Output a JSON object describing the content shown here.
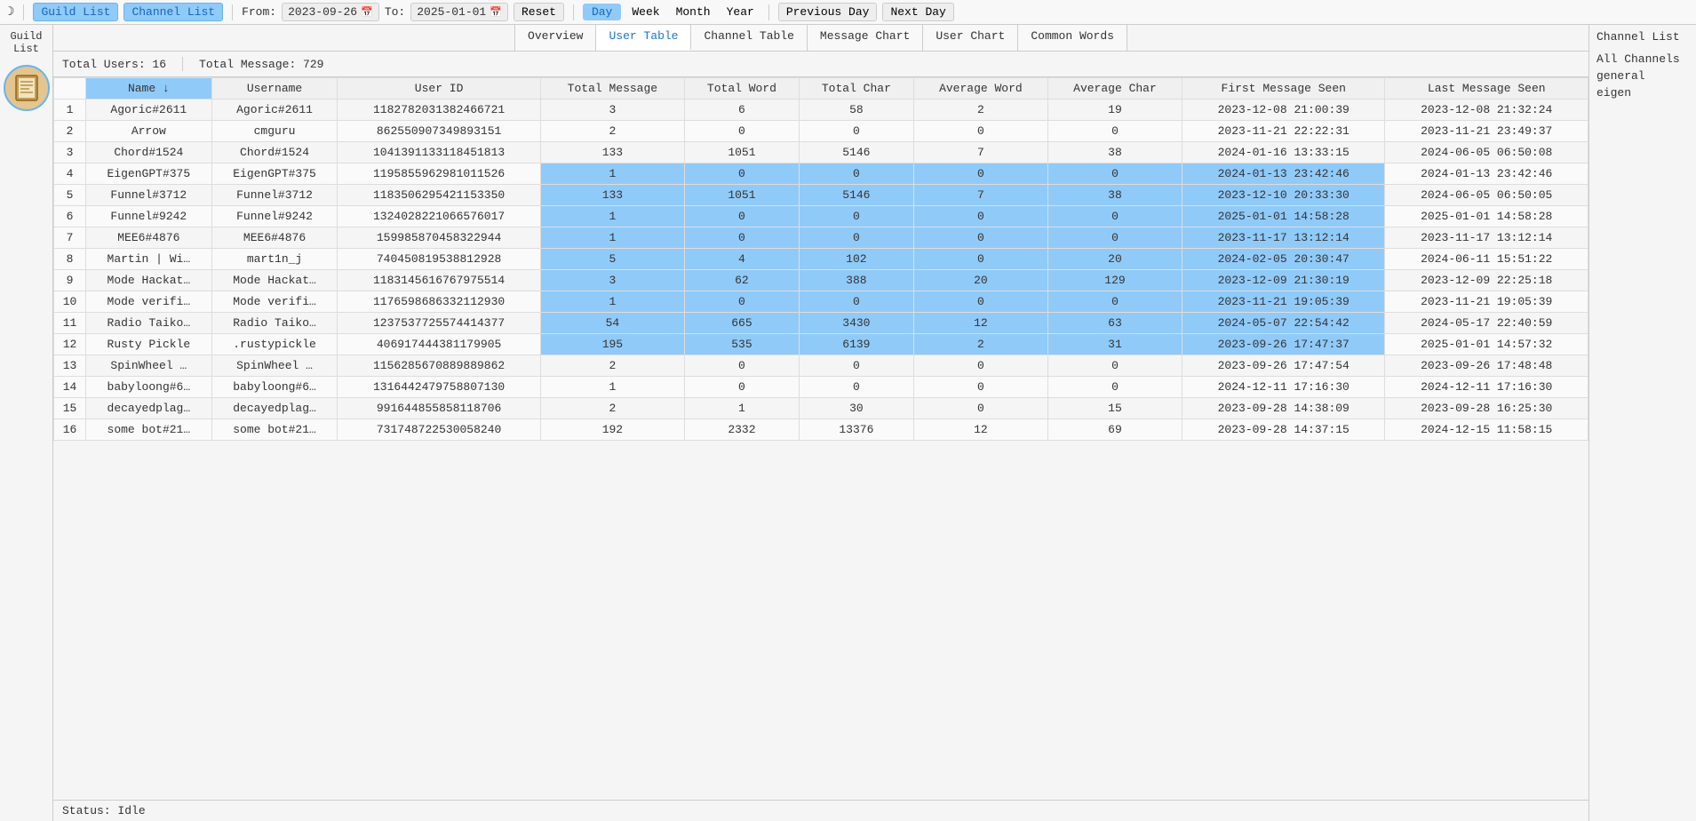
{
  "topbar": {
    "guild_list": "Guild List",
    "channel_list": "Channel List",
    "from_label": "From:",
    "from_date": "2023-09-26",
    "to_label": "To:",
    "to_date": "2025-01-01",
    "reset": "Reset",
    "day": "Day",
    "week": "Week",
    "month": "Month",
    "year": "Year",
    "prev_day": "Previous Day",
    "next_day": "Next Day"
  },
  "left_sidebar": {
    "title_line1": "Guild",
    "title_line2": "List"
  },
  "tabs": {
    "overview": "Overview",
    "user_table": "User Table",
    "channel_table": "Channel Table",
    "message_chart": "Message Chart",
    "user_chart": "User Chart",
    "common_words": "Common Words"
  },
  "stats": {
    "total_users": "Total Users: 16",
    "total_message": "Total Message: 729"
  },
  "columns": {
    "name": "Name ↓",
    "username": "Username",
    "user_id": "User ID",
    "total_msg": "Total Message",
    "total_word": "Total Word",
    "total_char": "Total Char",
    "avg_word": "Average Word",
    "avg_char": "Average Char",
    "first_seen": "First Message Seen",
    "last_seen": "Last Message Seen"
  },
  "rows": [
    {
      "n": "1",
      "name": "Agoric#2611",
      "user": "Agoric#2611",
      "id": "1182782031382466721",
      "tm": "3",
      "tw": "6",
      "tc": "58",
      "aw": "2",
      "ac": "19",
      "fs": "2023-12-08 21:00:39",
      "ls": "2023-12-08 21:32:24",
      "hl": false
    },
    {
      "n": "2",
      "name": "Arrow",
      "user": "cmguru",
      "id": "862550907349893151",
      "tm": "2",
      "tw": "0",
      "tc": "0",
      "aw": "0",
      "ac": "0",
      "fs": "2023-11-21 22:22:31",
      "ls": "2023-11-21 23:49:37",
      "hl": false
    },
    {
      "n": "3",
      "name": "Chord#1524",
      "user": "Chord#1524",
      "id": "1041391133118451813",
      "tm": "133",
      "tw": "1051",
      "tc": "5146",
      "aw": "7",
      "ac": "38",
      "fs": "2024-01-16 13:33:15",
      "ls": "2024-06-05 06:50:08",
      "hl": false
    },
    {
      "n": "4",
      "name": "EigenGPT#375",
      "user": "EigenGPT#375",
      "id": "1195855962981011526",
      "tm": "1",
      "tw": "0",
      "tc": "0",
      "aw": "0",
      "ac": "0",
      "fs": "2024-01-13 23:42:46",
      "ls": "2024-01-13 23:42:46",
      "hl": true
    },
    {
      "n": "5",
      "name": "Funnel#3712",
      "user": "Funnel#3712",
      "id": "1183506295421153350",
      "tm": "133",
      "tw": "1051",
      "tc": "5146",
      "aw": "7",
      "ac": "38",
      "fs": "2023-12-10 20:33:30",
      "ls": "2024-06-05 06:50:05",
      "hl": true
    },
    {
      "n": "6",
      "name": "Funnel#9242",
      "user": "Funnel#9242",
      "id": "1324028221066576017",
      "tm": "1",
      "tw": "0",
      "tc": "0",
      "aw": "0",
      "ac": "0",
      "fs": "2025-01-01 14:58:28",
      "ls": "2025-01-01 14:58:28",
      "hl": true
    },
    {
      "n": "7",
      "name": "MEE6#4876",
      "user": "MEE6#4876",
      "id": "159985870458322944",
      "tm": "1",
      "tw": "0",
      "tc": "0",
      "aw": "0",
      "ac": "0",
      "fs": "2023-11-17 13:12:14",
      "ls": "2023-11-17 13:12:14",
      "hl": true
    },
    {
      "n": "8",
      "name": "Martin | Wi…",
      "user": "mart1n_j",
      "id": "740450819538812928",
      "tm": "5",
      "tw": "4",
      "tc": "102",
      "aw": "0",
      "ac": "20",
      "fs": "2024-02-05 20:30:47",
      "ls": "2024-06-11 15:51:22",
      "hl": true
    },
    {
      "n": "9",
      "name": "Mode Hackat…",
      "user": "Mode Hackat…",
      "id": "1183145616767975514",
      "tm": "3",
      "tw": "62",
      "tc": "388",
      "aw": "20",
      "ac": "129",
      "fs": "2023-12-09 21:30:19",
      "ls": "2023-12-09 22:25:18",
      "hl": true
    },
    {
      "n": "10",
      "name": "Mode verifi…",
      "user": "Mode verifi…",
      "id": "1176598686332112930",
      "tm": "1",
      "tw": "0",
      "tc": "0",
      "aw": "0",
      "ac": "0",
      "fs": "2023-11-21 19:05:39",
      "ls": "2023-11-21 19:05:39",
      "hl": true
    },
    {
      "n": "11",
      "name": "Radio Taiko…",
      "user": "Radio Taiko…",
      "id": "1237537725574414377",
      "tm": "54",
      "tw": "665",
      "tc": "3430",
      "aw": "12",
      "ac": "63",
      "fs": "2024-05-07 22:54:42",
      "ls": "2024-05-17 22:40:59",
      "hl": true
    },
    {
      "n": "12",
      "name": "Rusty Pickle",
      "user": ".rustypickle",
      "id": "406917444381179905",
      "tm": "195",
      "tw": "535",
      "tc": "6139",
      "aw": "2",
      "ac": "31",
      "fs": "2023-09-26 17:47:37",
      "ls": "2025-01-01 14:57:32",
      "hl": true
    },
    {
      "n": "13",
      "name": "SpinWheel  …",
      "user": "SpinWheel  …",
      "id": "1156285670889889862",
      "tm": "2",
      "tw": "0",
      "tc": "0",
      "aw": "0",
      "ac": "0",
      "fs": "2023-09-26 17:47:54",
      "ls": "2023-09-26 17:48:48",
      "hl": false
    },
    {
      "n": "14",
      "name": "babyloong#6…",
      "user": "babyloong#6…",
      "id": "1316442479758807130",
      "tm": "1",
      "tw": "0",
      "tc": "0",
      "aw": "0",
      "ac": "0",
      "fs": "2024-12-11 17:16:30",
      "ls": "2024-12-11 17:16:30",
      "hl": false
    },
    {
      "n": "15",
      "name": "decayedplag…",
      "user": "decayedplag…",
      "id": "991644855858118706",
      "tm": "2",
      "tw": "1",
      "tc": "30",
      "aw": "0",
      "ac": "15",
      "fs": "2023-09-28 14:38:09",
      "ls": "2023-09-28 16:25:30",
      "hl": false
    },
    {
      "n": "16",
      "name": "some bot#21…",
      "user": "some bot#21…",
      "id": "731748722530058240",
      "tm": "192",
      "tw": "2332",
      "tc": "13376",
      "aw": "12",
      "ac": "69",
      "fs": "2023-09-28 14:37:15",
      "ls": "2024-12-15 11:58:15",
      "hl": false
    }
  ],
  "status": "Status: Idle",
  "right_sidebar": {
    "title": "Channel List",
    "items": [
      "All Channels",
      "general",
      "eigen"
    ]
  }
}
